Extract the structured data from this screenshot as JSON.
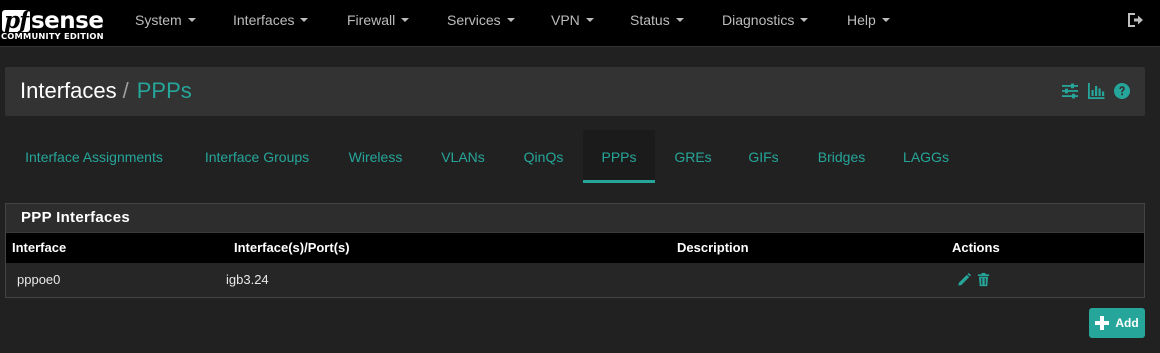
{
  "logo": {
    "brand_left": "pf",
    "brand_right": "sense",
    "edition": "COMMUNITY EDITION"
  },
  "nav": {
    "items": [
      {
        "label": "System"
      },
      {
        "label": "Interfaces"
      },
      {
        "label": "Firewall"
      },
      {
        "label": "Services"
      },
      {
        "label": "VPN"
      },
      {
        "label": "Status"
      },
      {
        "label": "Diagnostics"
      },
      {
        "label": "Help"
      }
    ],
    "logout_icon": "sign-out-icon"
  },
  "breadcrumb": {
    "root": "Interfaces",
    "separator": "/",
    "current": "PPPs"
  },
  "header_icons": [
    "sliders-icon",
    "bar-chart-icon",
    "question-circle-icon"
  ],
  "tabs": [
    {
      "label": "Interface Assignments"
    },
    {
      "label": "Interface Groups"
    },
    {
      "label": "Wireless"
    },
    {
      "label": "VLANs"
    },
    {
      "label": "QinQs"
    },
    {
      "label": "PPPs",
      "active": true
    },
    {
      "label": "GREs"
    },
    {
      "label": "GIFs"
    },
    {
      "label": "Bridges"
    },
    {
      "label": "LAGGs"
    }
  ],
  "panel": {
    "title": "PPP Interfaces",
    "columns": [
      "Interface",
      "Interface(s)/Port(s)",
      "Description",
      "Actions"
    ],
    "rows": [
      {
        "interface": "pppoe0",
        "ports": "igb3.24",
        "description": "",
        "actions": [
          "pencil-icon",
          "trash-icon"
        ]
      }
    ]
  },
  "add_button": {
    "label": "Add",
    "icon": "plus-icon"
  },
  "colors": {
    "accent": "#26a69a",
    "navbar": "#000000",
    "background": "#212121",
    "header": "#333333"
  }
}
